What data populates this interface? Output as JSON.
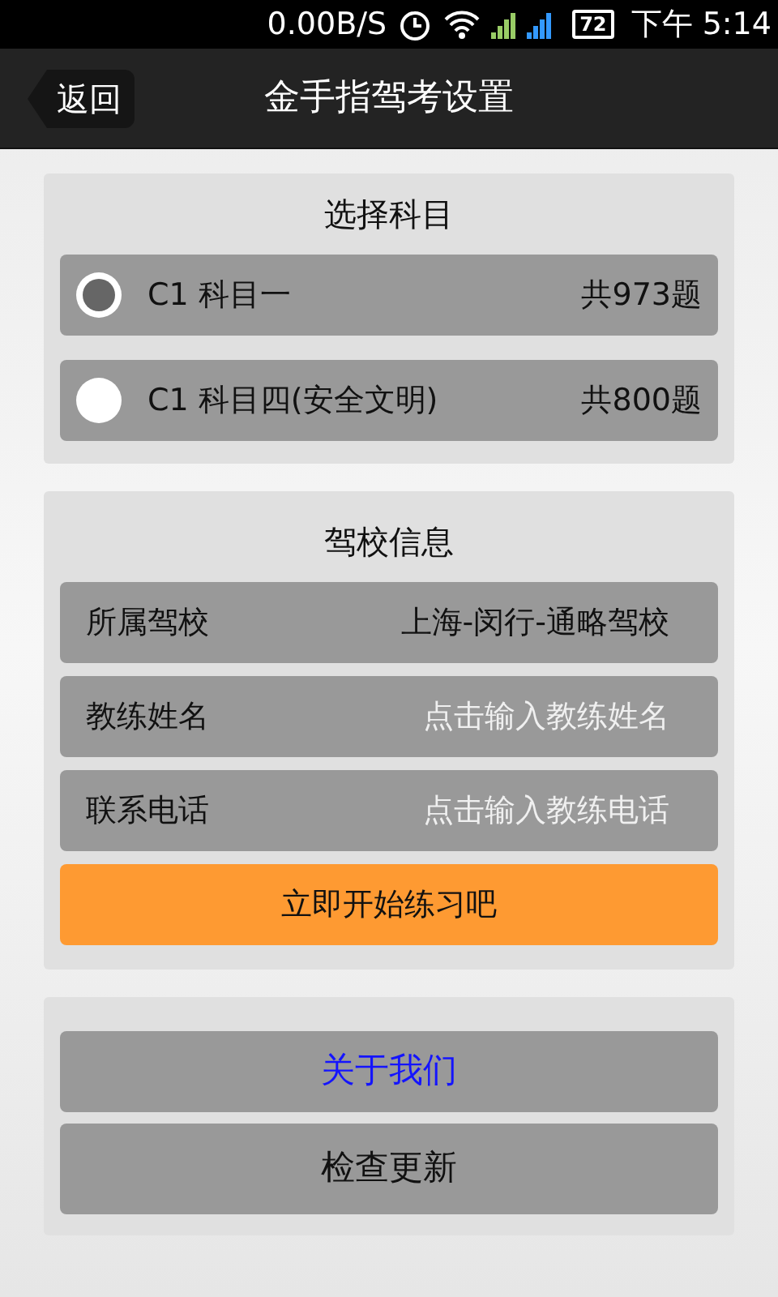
{
  "status_bar": {
    "speed": "0.00B/S",
    "battery": "72",
    "time": "下午 5:14"
  },
  "header": {
    "back": "返回",
    "title": "金手指驾考设置"
  },
  "subject_card": {
    "title": "选择科目",
    "options": [
      {
        "label": "C1 科目一",
        "count": "共973题",
        "selected": true
      },
      {
        "label": "C1 科目四(安全文明)",
        "count": "共800题",
        "selected": false
      }
    ]
  },
  "school_card": {
    "title": "驾校信息",
    "fields": [
      {
        "label": "所属驾校",
        "value": "上海-闵行-通略驾校"
      },
      {
        "label": "教练姓名",
        "placeholder": "点击输入教练姓名"
      },
      {
        "label": "联系电话",
        "placeholder": "点击输入教练电话"
      }
    ],
    "start_button": "立即开始练习吧"
  },
  "links": [
    {
      "label": "关于我们",
      "kind": "link"
    },
    {
      "label": "检查更新",
      "kind": "plain"
    }
  ]
}
